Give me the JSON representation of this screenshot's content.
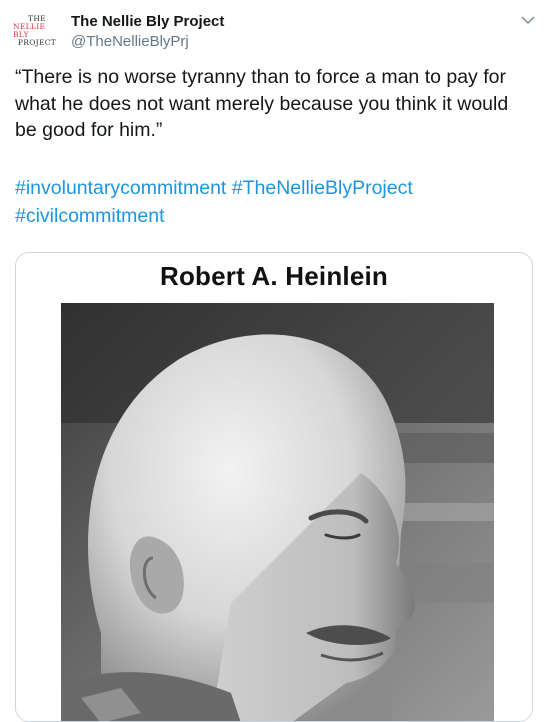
{
  "account": {
    "avatar_lines": [
      "THE",
      "NELLIE BLY",
      "PROJECT"
    ],
    "display_name": "The Nellie Bly Project",
    "handle": "@TheNellieBlyPrj"
  },
  "tweet": {
    "text": "“There is no worse tyranny than to force a man to pay for what he does not want merely because you think it would be good for him.”",
    "hashtags": [
      "#involuntarycommitment",
      "#TheNellieBlyProject",
      "#civilcommitment"
    ]
  },
  "media": {
    "title": "Robert A. Heinlein",
    "image_subject": "black-and-white photo of bald man in profile"
  },
  "colors": {
    "link": "#1b95e0",
    "name": "#14171a",
    "handle": "#657786",
    "border": "#ccd6dd",
    "avatar_accent": "#e02e3c"
  },
  "icons": {
    "menu": "chevron-down-icon"
  }
}
